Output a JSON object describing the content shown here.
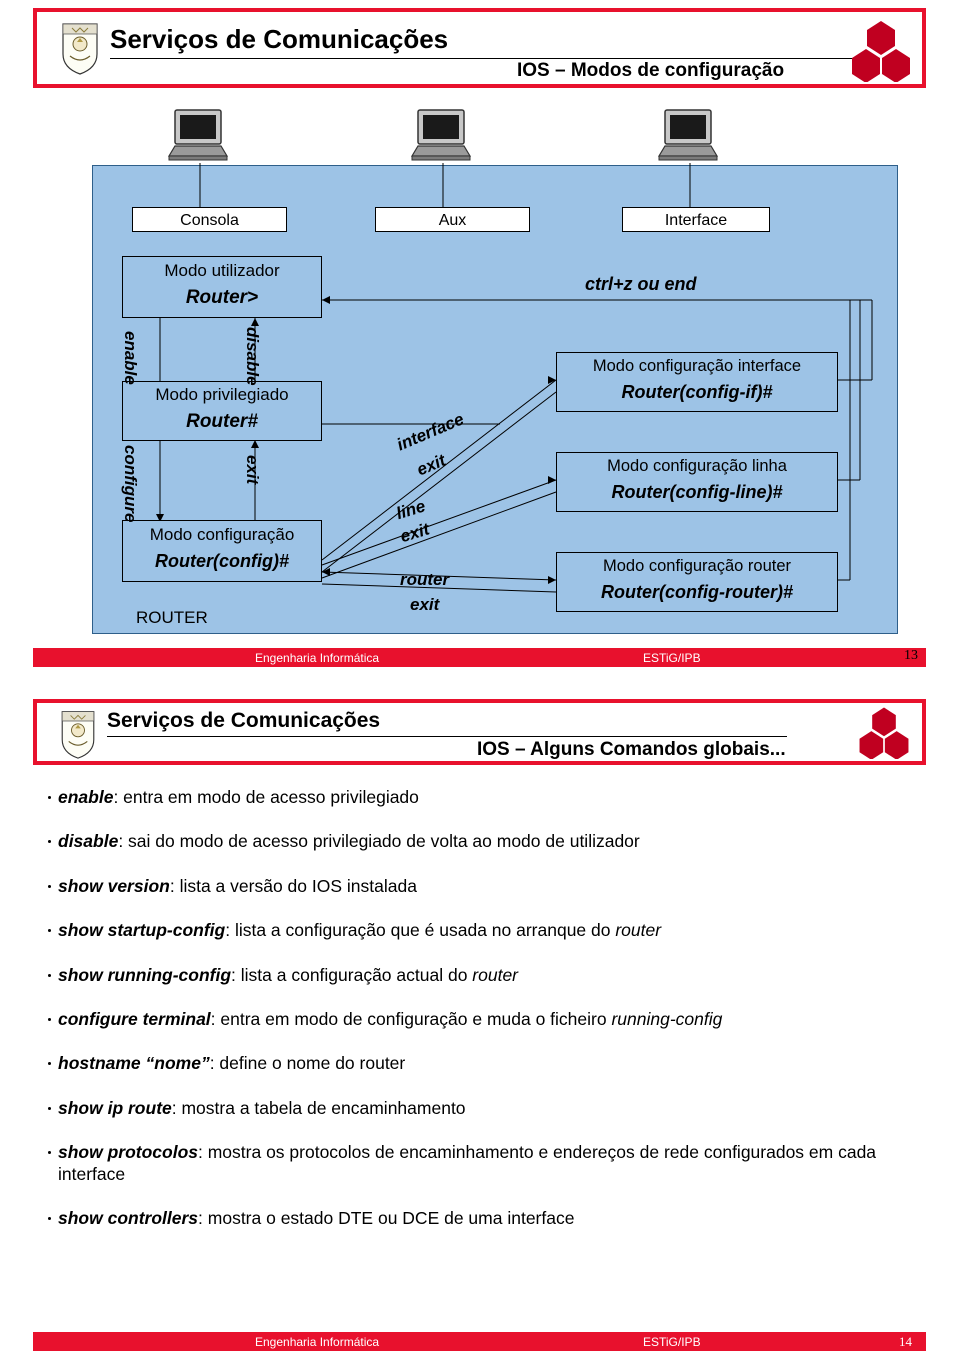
{
  "slide1": {
    "header": {
      "title": "Serviços de Comunicações",
      "subtitle": "IOS – Modos de configuração"
    },
    "diagram": {
      "terminals": [
        {
          "label": "Consola"
        },
        {
          "label": "Aux"
        },
        {
          "label": "Interface"
        }
      ],
      "left_boxes": [
        {
          "title": "Modo utilizador",
          "prompt": "Router>"
        },
        {
          "title": "Modo privilegiado",
          "prompt": "Router#"
        },
        {
          "title": "Modo configuração",
          "prompt": "Router(config)#"
        }
      ],
      "router_label": "ROUTER",
      "right_boxes": [
        {
          "title": "Modo configuração interface",
          "prompt": "Router(config-if)#"
        },
        {
          "title": "Modo configuração linha",
          "prompt": "Router(config-line)#"
        },
        {
          "title": "Modo configuração router",
          "prompt": "Router(config-router)#"
        }
      ],
      "transitions": {
        "enable": "enable",
        "disable": "disable",
        "configure": "configure",
        "exit1": "exit",
        "ctrlz": "ctrl+z ou end",
        "interface": "interface",
        "exit_if": "exit",
        "line": "line",
        "exit_line": "exit",
        "router": "router",
        "exit_router": "exit"
      }
    },
    "footer": {
      "left": "Engenharia Informática",
      "middle": "ESTiG/IPB",
      "page": "13"
    }
  },
  "slide2": {
    "header": {
      "title": "Serviços de Comunicações",
      "subtitle": "IOS – Alguns Comandos globais..."
    },
    "commands": [
      {
        "cmd": "enable",
        "desc": ": entra em modo de acesso privilegiado"
      },
      {
        "cmd": "disable",
        "desc": ": sai do modo de acesso privilegiado de volta ao modo de utilizador"
      },
      {
        "cmd": "show version",
        "desc": ": lista a versão do IOS instalada"
      },
      {
        "cmd": "show startup-config",
        "desc": ": lista a configuração que é usada no arranque do ",
        "em": "router"
      },
      {
        "cmd": "show running-config",
        "desc": ": lista a configuração actual do ",
        "em": "router"
      },
      {
        "cmd": "configure terminal",
        "desc": ": entra em modo de configuração e muda o ficheiro ",
        "em": "running-config"
      },
      {
        "cmd": "hostname “nome”",
        "desc": ": define o nome do router"
      },
      {
        "cmd": "show ip route",
        "desc": ": mostra a tabela de encaminhamento"
      },
      {
        "cmd": "show protocolos",
        "desc": ": mostra os protocolos de encaminhamento e endereços de rede configurados em cada interface"
      },
      {
        "cmd": "show controllers",
        "desc": ": mostra o estado DTE ou DCE de uma interface"
      }
    ],
    "footer": {
      "left": "Engenharia Informática",
      "middle": "ESTiG/IPB",
      "page": "14"
    }
  },
  "colors": {
    "accent_red": "#e8112d",
    "diagram_fill": "#9dc3e6",
    "logo_red": "#c00020"
  }
}
